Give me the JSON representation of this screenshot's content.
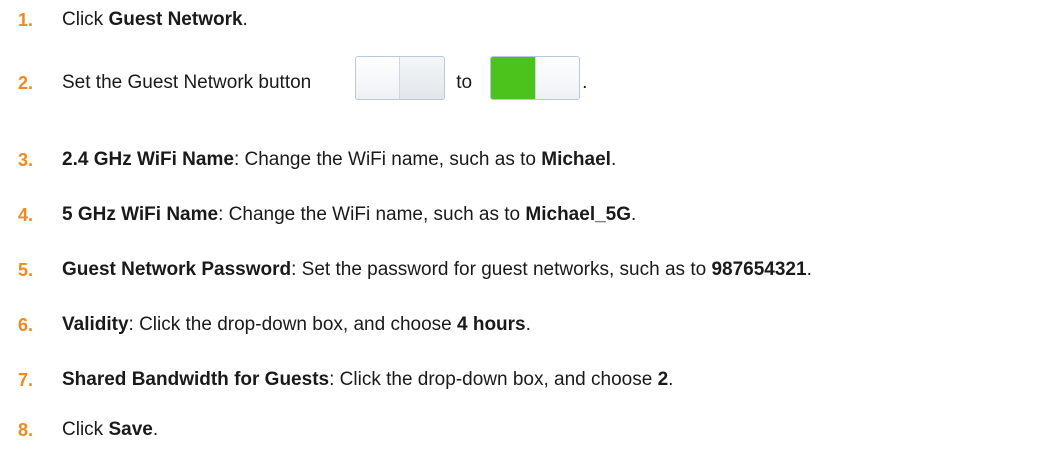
{
  "steps": [
    {
      "num": "1.",
      "pre": "Click ",
      "bold": "Guest Network",
      "post": "."
    },
    {
      "num": "2.",
      "pre": "Set the Guest Network button",
      "mid": "to",
      "post": "."
    },
    {
      "num": "3.",
      "bold": "2.4 GHz WiFi Name",
      "pre": ": Change the WiFi name, such as to ",
      "bold2": "Michael",
      "post": "."
    },
    {
      "num": "4.",
      "bold": "5 GHz WiFi Name",
      "pre": ": Change the WiFi name, such as to ",
      "bold2": "Michael_5G",
      "post": "."
    },
    {
      "num": "5.",
      "bold": "Guest Network Password",
      "pre": ": Set the password for guest networks, such as to ",
      "bold2": "987654321",
      "post": "."
    },
    {
      "num": "6.",
      "bold": "Validity",
      "pre": ": Click the drop-down box, and choose ",
      "bold2": "4 hours",
      "post": "."
    },
    {
      "num": "7.",
      "bold": "Shared Bandwidth for Guests",
      "pre": ": Click the drop-down box, and choose ",
      "bold2": "2",
      "post": "."
    },
    {
      "num": "8.",
      "pre": "Click ",
      "bold": "Save",
      "post": "."
    }
  ],
  "colors": {
    "step_number": "#f08a1d",
    "toggle_on": "#4cc21c",
    "text": "#1a1a1a"
  },
  "icons": {
    "toggle_off": "toggle-switch-off-icon",
    "toggle_on": "toggle-switch-on-icon"
  }
}
